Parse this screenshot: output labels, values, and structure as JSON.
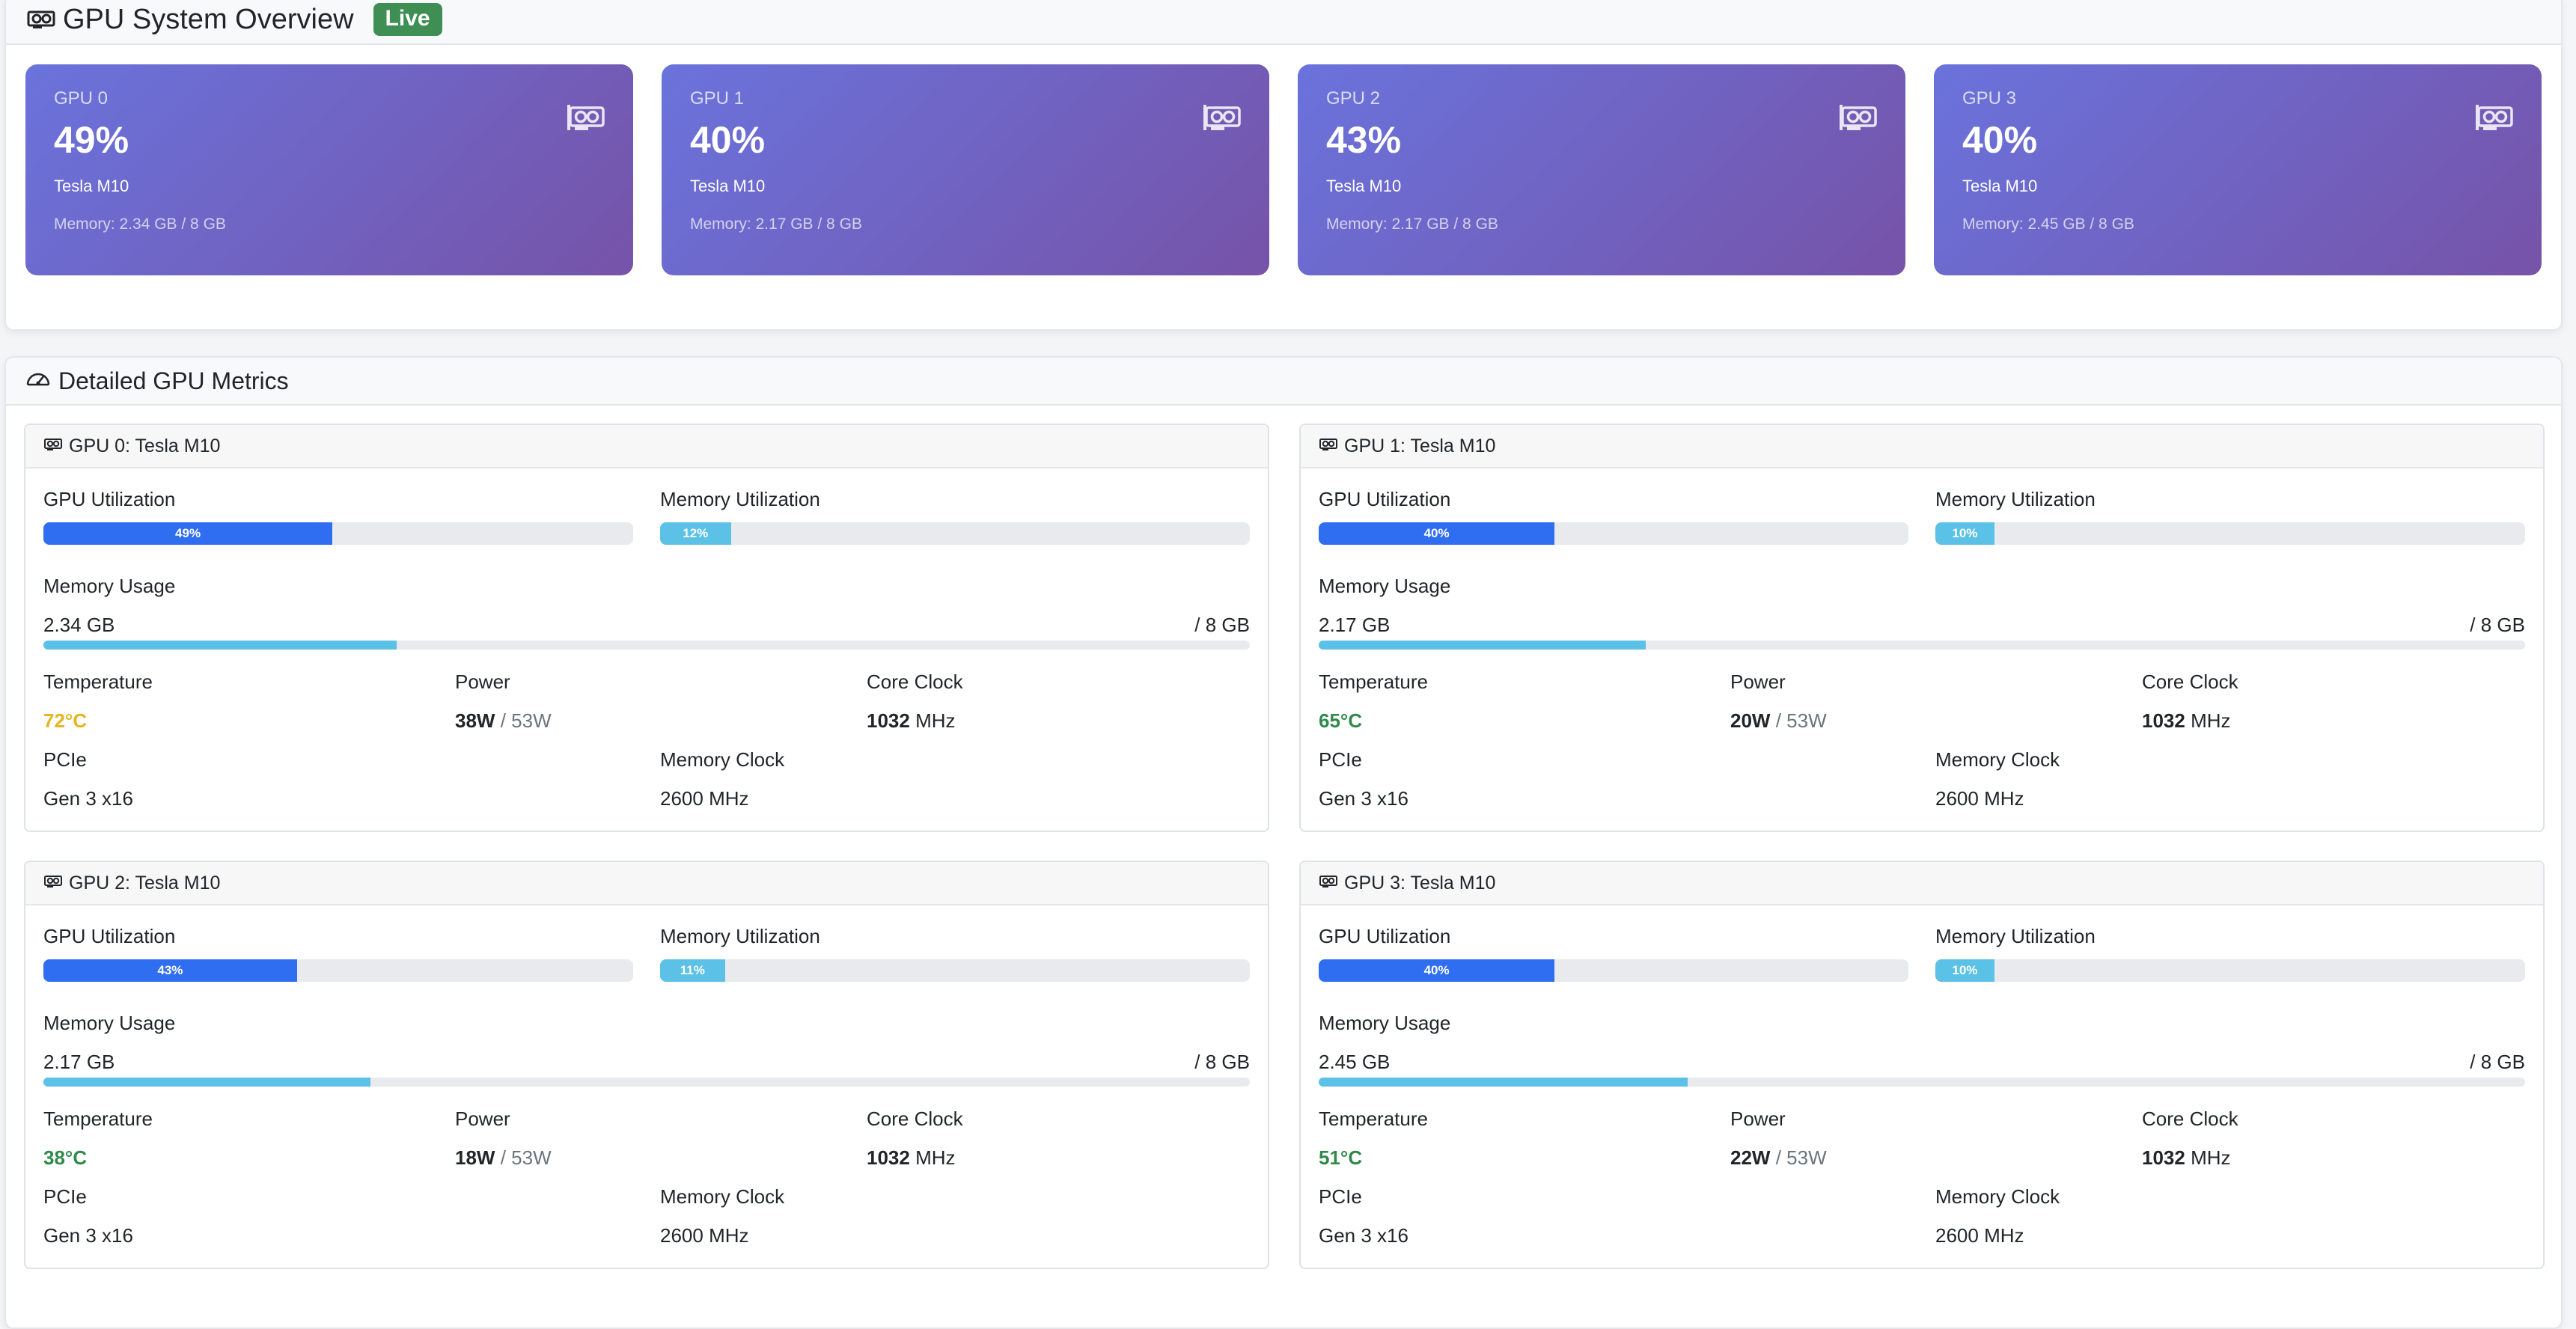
{
  "overview": {
    "title": "GPU System Overview",
    "badge": "Live",
    "gpus": [
      {
        "name": "GPU 0",
        "util": "49%",
        "model": "Tesla M10",
        "memory": "Memory: 2.34 GB / 8 GB"
      },
      {
        "name": "GPU 1",
        "util": "40%",
        "model": "Tesla M10",
        "memory": "Memory: 2.17 GB / 8 GB"
      },
      {
        "name": "GPU 2",
        "util": "43%",
        "model": "Tesla M10",
        "memory": "Memory: 2.17 GB / 8 GB"
      },
      {
        "name": "GPU 3",
        "util": "40%",
        "model": "Tesla M10",
        "memory": "Memory: 2.45 GB / 8 GB"
      }
    ]
  },
  "details": {
    "title": "Detailed GPU Metrics",
    "labels": {
      "gpu_util": "GPU Utilization",
      "mem_util": "Memory Utilization",
      "mem_usage": "Memory Usage",
      "temperature": "Temperature",
      "power": "Power",
      "core_clock": "Core Clock",
      "pcie": "PCIe",
      "mem_clock": "Memory Clock"
    },
    "gpus": [
      {
        "title": "GPU 0: Tesla M10",
        "gpu_util": "49%",
        "gpu_util_frac": 0.49,
        "mem_util": "12%",
        "mem_util_frac": 0.12,
        "mem_used": "2.34 GB",
        "mem_total": "/ 8 GB",
        "mem_frac": 0.2925,
        "temp": "72°C",
        "temp_status": "warn",
        "power": "38W",
        "power_max": "/ 53W",
        "core_clock": "1032",
        "core_clock_unit": "MHz",
        "pcie": "Gen 3 x16",
        "mem_clock": "2600 MHz"
      },
      {
        "title": "GPU 1: Tesla M10",
        "gpu_util": "40%",
        "gpu_util_frac": 0.4,
        "mem_util": "10%",
        "mem_util_frac": 0.1,
        "mem_used": "2.17 GB",
        "mem_total": "/ 8 GB",
        "mem_frac": 0.271,
        "temp": "65°C",
        "temp_status": "ok",
        "power": "20W",
        "power_max": "/ 53W",
        "core_clock": "1032",
        "core_clock_unit": "MHz",
        "pcie": "Gen 3 x16",
        "mem_clock": "2600 MHz"
      },
      {
        "title": "GPU 2: Tesla M10",
        "gpu_util": "43%",
        "gpu_util_frac": 0.43,
        "mem_util": "11%",
        "mem_util_frac": 0.11,
        "mem_used": "2.17 GB",
        "mem_total": "/ 8 GB",
        "mem_frac": 0.271,
        "temp": "38°C",
        "temp_status": "ok",
        "power": "18W",
        "power_max": "/ 53W",
        "core_clock": "1032",
        "core_clock_unit": "MHz",
        "pcie": "Gen 3 x16",
        "mem_clock": "2600 MHz"
      },
      {
        "title": "GPU 3: Tesla M10",
        "gpu_util": "40%",
        "gpu_util_frac": 0.4,
        "mem_util": "10%",
        "mem_util_frac": 0.1,
        "mem_used": "2.45 GB",
        "mem_total": "/ 8 GB",
        "mem_frac": 0.306,
        "temp": "51°C",
        "temp_status": "ok",
        "power": "22W",
        "power_max": "/ 53W",
        "core_clock": "1032",
        "core_clock_unit": "MHz",
        "pcie": "Gen 3 x16",
        "mem_clock": "2600 MHz"
      }
    ]
  },
  "icons": {
    "gpu": "gpu-card-icon",
    "speedometer": "speedometer-icon"
  },
  "colors": {
    "card_gradient_start": "#6a73dc",
    "card_gradient_end": "#7653a8",
    "live_badge": "#3f8f55",
    "gpu_util_bar": "#2f6ef0",
    "mem_bar": "#5bc1e6",
    "temp_warn": "#e6b520",
    "temp_ok": "#2f8a4a"
  }
}
